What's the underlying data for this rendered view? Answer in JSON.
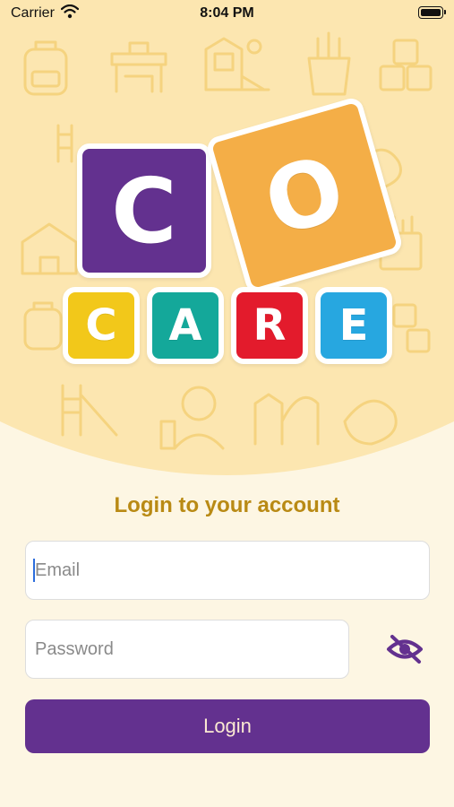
{
  "status_bar": {
    "carrier": "Carrier",
    "time": "8:04 PM"
  },
  "logo": {
    "letters_top": [
      "C",
      "O"
    ],
    "letters_bottom": [
      "C",
      "A",
      "R",
      "E"
    ]
  },
  "login": {
    "title": "Login to your account",
    "email_placeholder": "Email",
    "password_placeholder": "Password",
    "button_label": "Login",
    "toggle_icon": "eye-slash-icon"
  },
  "colors": {
    "primary": "#63318f",
    "title": "#b98a14",
    "hero_bg": "#fce6b0",
    "page_bg": "#fdf6e3",
    "tile_orange": "#f4ae47",
    "tile_yellow": "#f2c81a",
    "tile_teal": "#14a89a",
    "tile_red": "#e31b2c",
    "tile_blue": "#27a7e0"
  }
}
